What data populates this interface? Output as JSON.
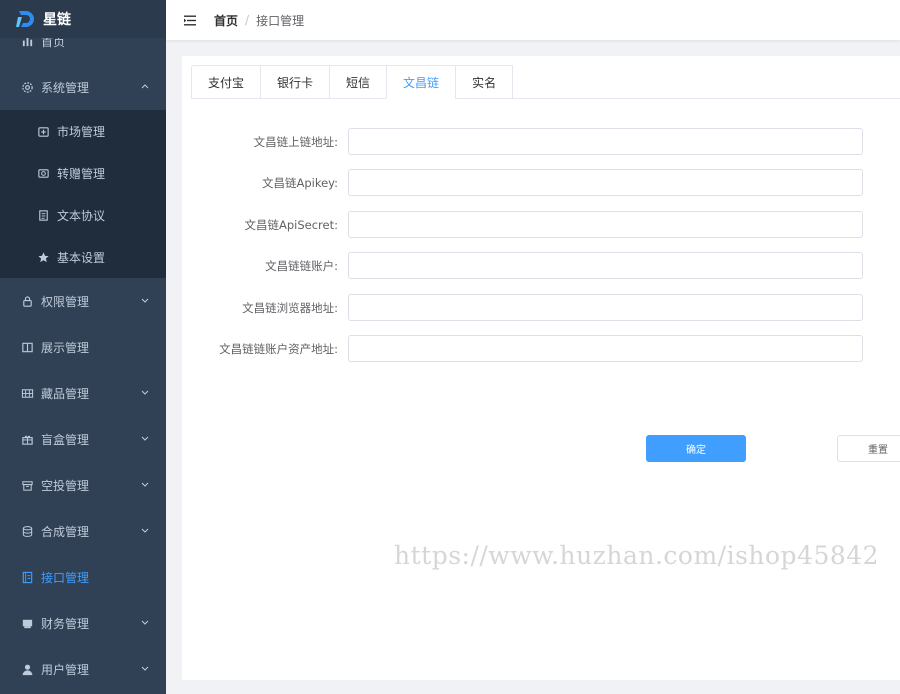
{
  "app": {
    "title": "星链"
  },
  "sidebar": {
    "items": [
      {
        "label": "首页",
        "icon": "bar-chart-icon"
      },
      {
        "label": "系统管理",
        "icon": "gear-icon",
        "expanded": true
      },
      {
        "label": "市场管理",
        "icon": "market-icon"
      },
      {
        "label": "转赠管理",
        "icon": "transfer-icon"
      },
      {
        "label": "文本协议",
        "icon": "document-icon"
      },
      {
        "label": "基本设置",
        "icon": "star-icon"
      },
      {
        "label": "权限管理",
        "icon": "lock-icon"
      },
      {
        "label": "展示管理",
        "icon": "book-icon"
      },
      {
        "label": "藏品管理",
        "icon": "grid-icon"
      },
      {
        "label": "盲盒管理",
        "icon": "gift-icon"
      },
      {
        "label": "空投管理",
        "icon": "box-icon"
      },
      {
        "label": "合成管理",
        "icon": "database-icon"
      },
      {
        "label": "接口管理",
        "icon": "api-icon",
        "active": true
      },
      {
        "label": "财务管理",
        "icon": "wallet-icon"
      },
      {
        "label": "用户管理",
        "icon": "user-icon"
      }
    ],
    "active_color": "#409eff"
  },
  "header": {
    "breadcrumb": {
      "home": "首页",
      "separator": "/",
      "current": "接口管理"
    }
  },
  "tabs": [
    "支付宝",
    "银行卡",
    "短信",
    "文昌链",
    "实名"
  ],
  "active_tab": "文昌链",
  "form": {
    "fields": [
      {
        "label": "文昌链上链地址:",
        "value": ""
      },
      {
        "label": "文昌链Apikey:",
        "value": ""
      },
      {
        "label": "文昌链ApiSecret:",
        "value": ""
      },
      {
        "label": "文昌链链账户:",
        "value": ""
      },
      {
        "label": "文昌链浏览器地址:",
        "value": ""
      },
      {
        "label": "文昌链链账户资产地址:",
        "value": ""
      }
    ],
    "confirm_label": "确定",
    "reset_label": "重置"
  },
  "watermark": "https://www.huzhan.com/ishop45842"
}
